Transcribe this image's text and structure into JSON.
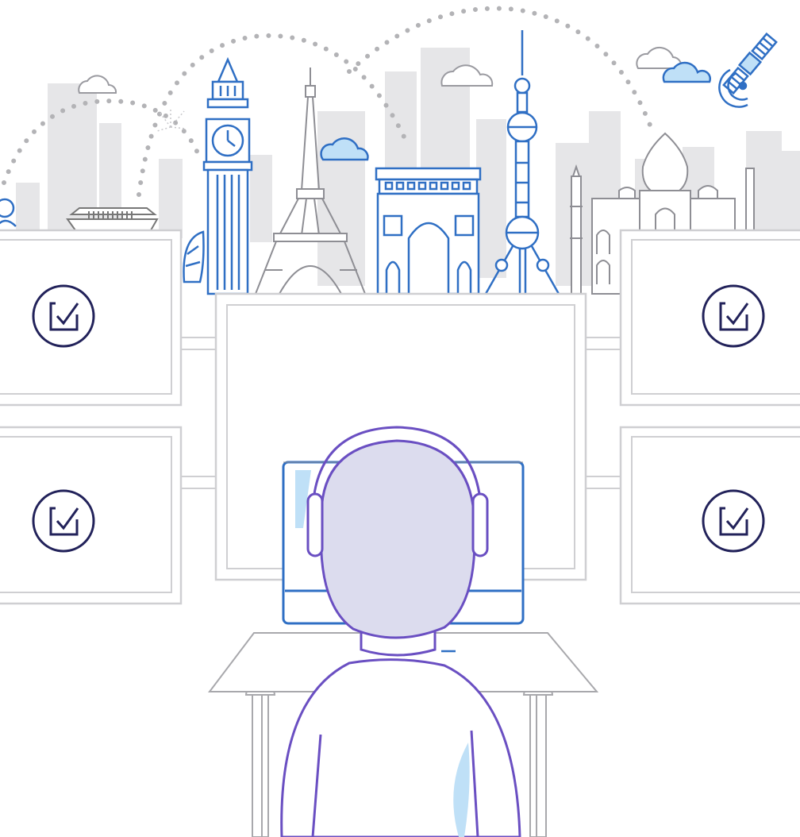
{
  "illustration": {
    "check_icon_count": 4,
    "icons": {
      "check": "checkbox-check-icon",
      "satellite": "satellite-icon",
      "cloud": "cloud-icon"
    },
    "landmarks": [
      "big-ben-icon",
      "eiffel-tower-icon",
      "arc-de-triomphe-icon",
      "oriental-pearl-tower-icon",
      "taj-mahal-icon",
      "sydney-opera-house-icon",
      "chinese-boat-icon"
    ]
  },
  "colors": {
    "navy": "#22225a",
    "blue": "#2f6fc4",
    "light_blue": "#bfe0f7",
    "purple": "#6a4fc2",
    "lavender": "#dcdcee",
    "skyline_gray": "#e5e5e7",
    "frame_gray": "#cfcfd2",
    "dots_gray": "#b3b3b6"
  }
}
